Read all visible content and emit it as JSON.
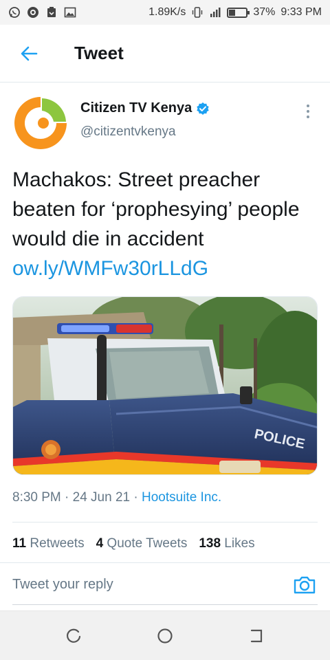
{
  "status_bar": {
    "speed": "1.89K/s",
    "battery_percent": "37%",
    "battery_level": 0.37,
    "time": "9:33 PM",
    "icons": [
      "whatsapp-icon",
      "app-icon",
      "download-icon",
      "image-icon",
      "vibrate-icon",
      "signal-icon",
      "battery-icon"
    ]
  },
  "header": {
    "title": "Tweet",
    "back_icon": "arrow-left-icon"
  },
  "tweet": {
    "author_name": "Citizen TV Kenya",
    "verified_icon": "verified-badge-icon",
    "handle": "@citizentvkenya",
    "text": "Machakos: Street preacher beaten for ‘prophesying’ people would die in accident",
    "link": "ow.ly/WMFw30rLLdG",
    "timestamp": "8:30 PM · 24 Jun 21 · ",
    "source": "Hootsuite Inc.",
    "media_text": "POLICE"
  },
  "stats": {
    "retweets_count": "11",
    "retweets_label": " Retweets",
    "quote_count": "4",
    "quote_label": " Quote Tweets",
    "likes_count": "138",
    "likes_label": " Likes"
  },
  "reply": {
    "placeholder": "Tweet your reply",
    "camera_icon": "camera-icon"
  },
  "nav": {
    "icons": [
      "recents-icon",
      "home-icon",
      "back-icon"
    ]
  },
  "colors": {
    "accent": "#1da1f2",
    "link": "#1b95e0",
    "text": "#14171a",
    "muted": "#657786",
    "avatar_orange": "#f7941d",
    "avatar_green": "#8dc63f"
  }
}
